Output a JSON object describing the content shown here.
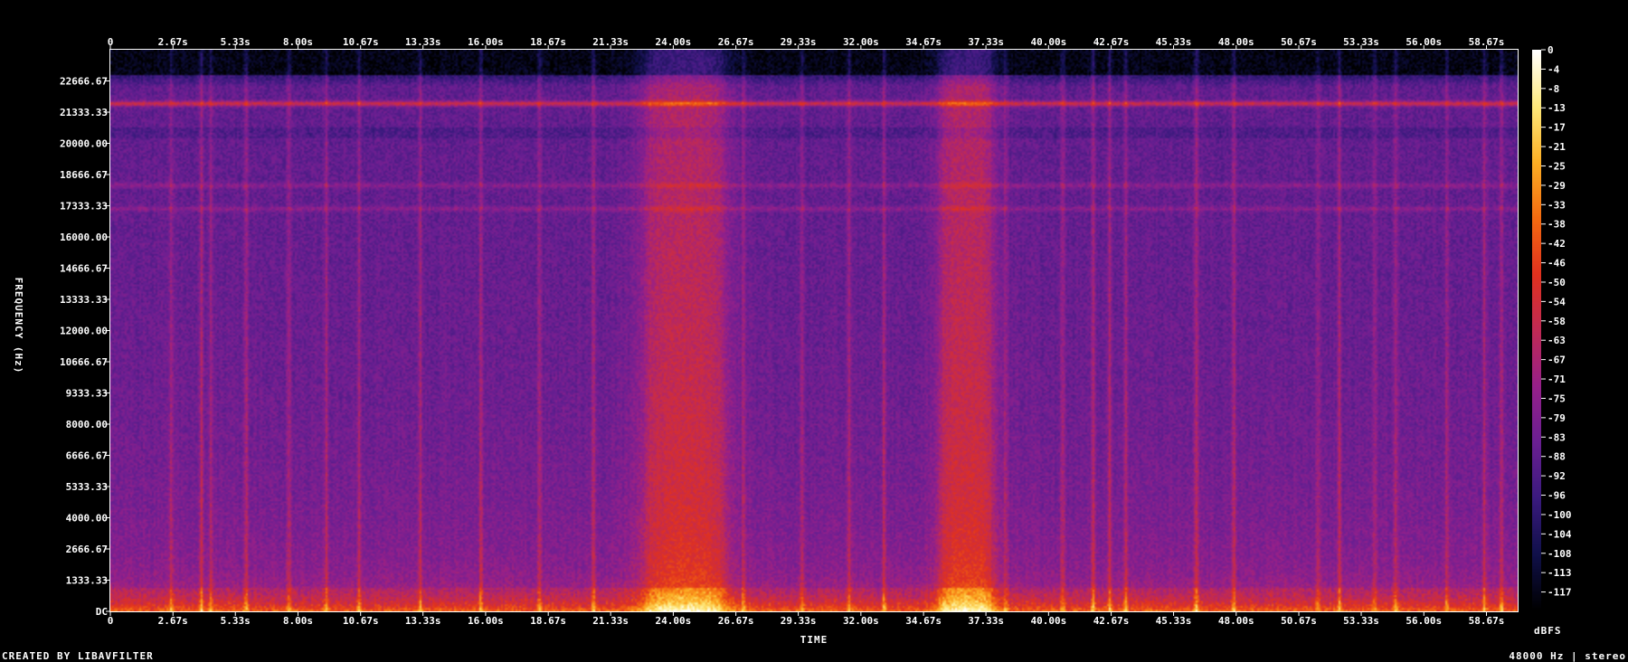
{
  "chart_data": {
    "type": "heatmap",
    "subtype": "spectrogram",
    "xlabel": "TIME",
    "ylabel": "FREQUENCY (Hz)",
    "colorbar_label": "dBFS",
    "credit": "CREATED BY LIBAVFILTER",
    "info": "48000 Hz | stereo",
    "sample_rate_hz": 48000,
    "channels": "stereo",
    "xlim": [
      0,
      60
    ],
    "ylim": [
      0,
      24000
    ],
    "x_ticks": [
      {
        "value": 0,
        "label": "0"
      },
      {
        "value": 2.67,
        "label": "2.67s"
      },
      {
        "value": 5.33,
        "label": "5.33s"
      },
      {
        "value": 8.0,
        "label": "8.00s"
      },
      {
        "value": 10.67,
        "label": "10.67s"
      },
      {
        "value": 13.33,
        "label": "13.33s"
      },
      {
        "value": 16.0,
        "label": "16.00s"
      },
      {
        "value": 18.67,
        "label": "18.67s"
      },
      {
        "value": 21.33,
        "label": "21.33s"
      },
      {
        "value": 24.0,
        "label": "24.00s"
      },
      {
        "value": 26.67,
        "label": "26.67s"
      },
      {
        "value": 29.33,
        "label": "29.33s"
      },
      {
        "value": 32.0,
        "label": "32.00s"
      },
      {
        "value": 34.67,
        "label": "34.67s"
      },
      {
        "value": 37.33,
        "label": "37.33s"
      },
      {
        "value": 40.0,
        "label": "40.00s"
      },
      {
        "value": 42.67,
        "label": "42.67s"
      },
      {
        "value": 45.33,
        "label": "45.33s"
      },
      {
        "value": 48.0,
        "label": "48.00s"
      },
      {
        "value": 50.67,
        "label": "50.67s"
      },
      {
        "value": 53.33,
        "label": "53.33s"
      },
      {
        "value": 56.0,
        "label": "56.00s"
      },
      {
        "value": 58.67,
        "label": "58.67s"
      }
    ],
    "y_ticks": [
      {
        "value": 0,
        "label": "DC"
      },
      {
        "value": 1333.33,
        "label": "1333.33"
      },
      {
        "value": 2666.67,
        "label": "2666.67"
      },
      {
        "value": 4000,
        "label": "4000.00"
      },
      {
        "value": 5333.33,
        "label": "5333.33"
      },
      {
        "value": 6666.67,
        "label": "6666.67"
      },
      {
        "value": 8000,
        "label": "8000.00"
      },
      {
        "value": 9333.33,
        "label": "9333.33"
      },
      {
        "value": 10666.67,
        "label": "10666.67"
      },
      {
        "value": 12000,
        "label": "12000.00"
      },
      {
        "value": 13333.33,
        "label": "13333.33"
      },
      {
        "value": 14666.67,
        "label": "14666.67"
      },
      {
        "value": 16000,
        "label": "16000.00"
      },
      {
        "value": 17333.33,
        "label": "17333.33"
      },
      {
        "value": 18666.67,
        "label": "18666.67"
      },
      {
        "value": 20000,
        "label": "20000.00"
      },
      {
        "value": 21333.33,
        "label": "21333.33"
      },
      {
        "value": 22666.67,
        "label": "22666.67"
      }
    ],
    "colorbar_range": [
      -120,
      0
    ],
    "colorbar_ticks": [
      "0",
      "-4",
      "-8",
      "-13",
      "-17",
      "-21",
      "-25",
      "-29",
      "-33",
      "-38",
      "-42",
      "-46",
      "-50",
      "-54",
      "-58",
      "-63",
      "-67",
      "-71",
      "-75",
      "-79",
      "-83",
      "-88",
      "-92",
      "-96",
      "-100",
      "-104",
      "-108",
      "-113",
      "-117"
    ],
    "colormap": [
      "#000000",
      "#10104a",
      "#3a1a7e",
      "#6a1f92",
      "#96208a",
      "#c02a55",
      "#e0311f",
      "#f46a10",
      "#fcae24",
      "#fde87a",
      "#ffffff"
    ],
    "features": {
      "horizontal_bands_hz": [
        21700,
        18200,
        17200
      ],
      "noise_floor_db": -84,
      "loud_time_ranges_s": [
        [
          23.0,
          26.0
        ],
        [
          35.5,
          37.5
        ]
      ],
      "transient_times_s": [
        2.6,
        3.9,
        4.3,
        5.8,
        7.6,
        9.2,
        10.6,
        13.2,
        15.8,
        18.3,
        20.6,
        27.0,
        29.5,
        31.5,
        33.0,
        38.2,
        40.6,
        41.9,
        42.6,
        43.3,
        46.3,
        47.9,
        51.5,
        52.4,
        53.9,
        54.8,
        57.0,
        58.6,
        59.3
      ]
    }
  }
}
